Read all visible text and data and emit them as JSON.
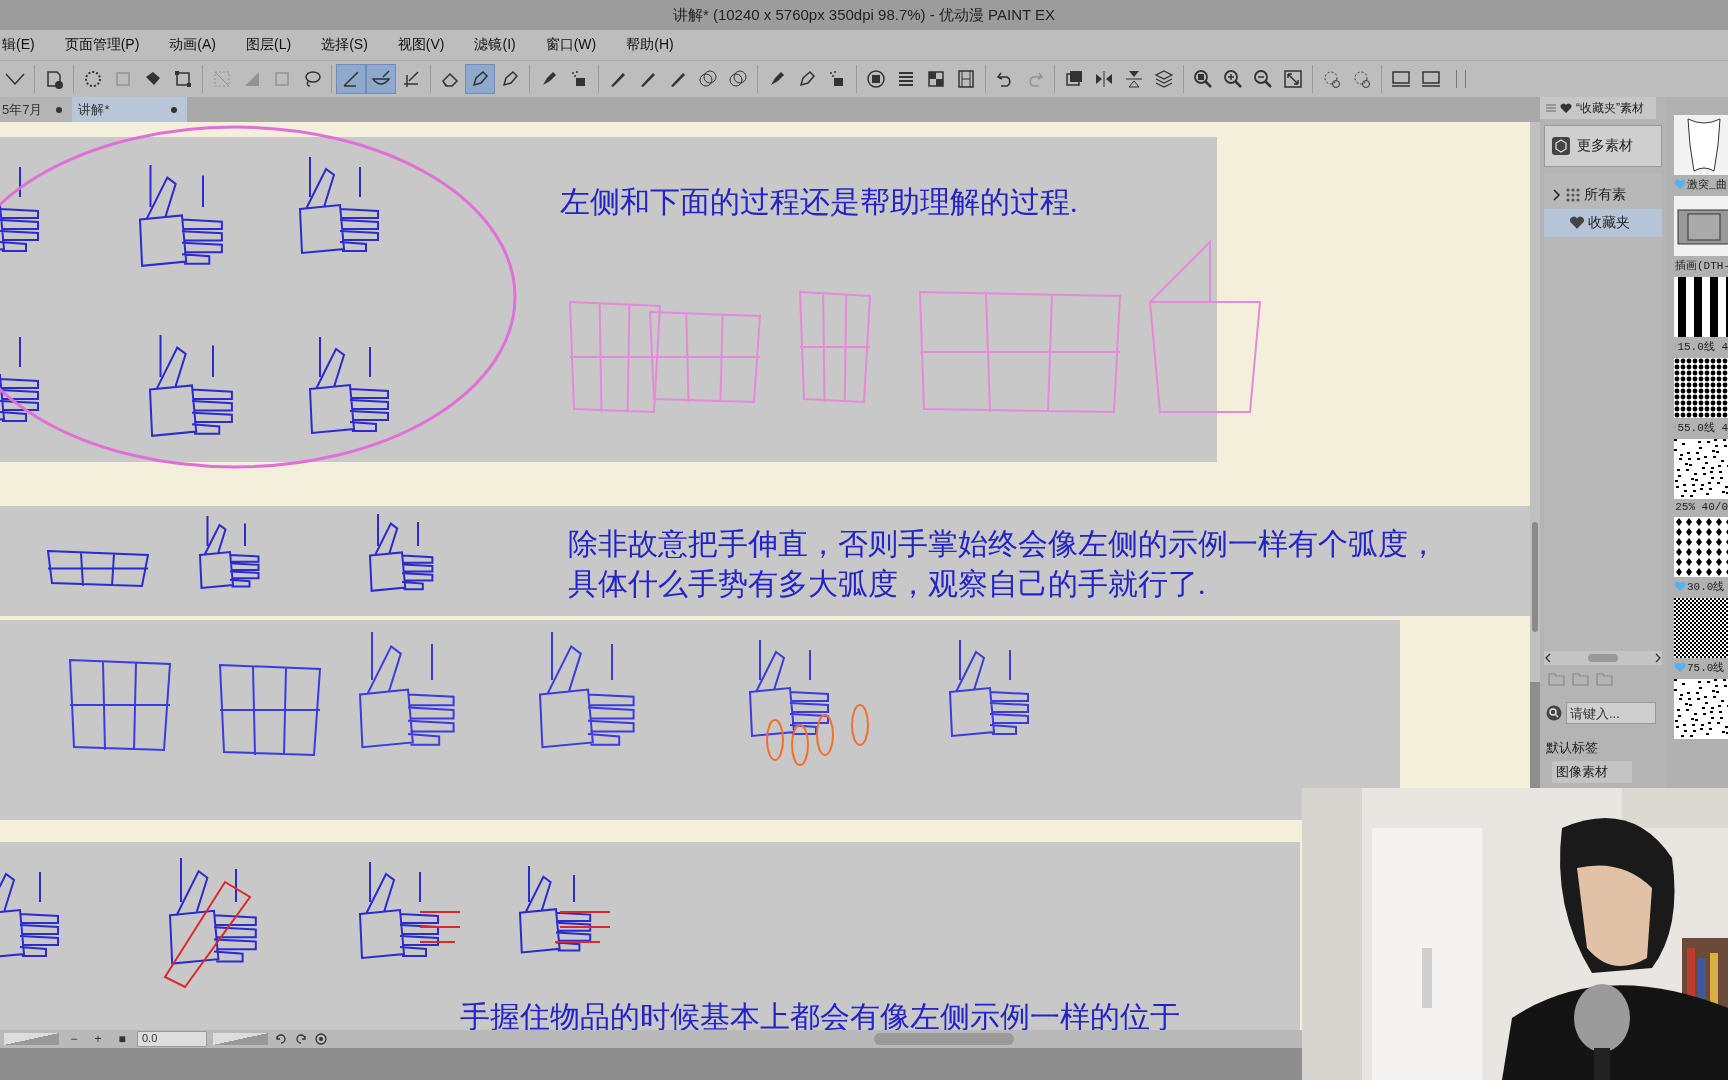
{
  "window": {
    "title": "讲解* (10240 x 5760px 350dpi 98.7%)  - 优动漫 PAINT EX"
  },
  "menu": [
    "辑(E)",
    "页面管理(P)",
    "动画(A)",
    "图层(L)",
    "选择(S)",
    "视图(V)",
    "滤镜(I)",
    "窗口(W)",
    "帮助(H)"
  ],
  "toolbar": [
    {
      "kind": "caret",
      "selected": false,
      "disabled": false
    },
    {
      "kind": "newpage",
      "selected": false,
      "disabled": false
    },
    {
      "kind": "dotcircle",
      "selected": false,
      "disabled": false
    },
    {
      "kind": "square",
      "selected": false,
      "disabled": true
    },
    {
      "kind": "bucket",
      "selected": false,
      "disabled": false
    },
    {
      "kind": "transform",
      "selected": false,
      "disabled": false
    },
    {
      "kind": "diagonal",
      "selected": false,
      "disabled": true
    },
    {
      "kind": "triangle",
      "selected": false,
      "disabled": true
    },
    {
      "kind": "square",
      "selected": false,
      "disabled": true
    },
    {
      "kind": "lasso",
      "selected": false,
      "disabled": false
    },
    {
      "kind": "ruler",
      "selected": true,
      "disabled": false
    },
    {
      "kind": "curve",
      "selected": true,
      "disabled": false
    },
    {
      "kind": "angle",
      "selected": false,
      "disabled": false
    },
    {
      "kind": "eraser",
      "selected": false,
      "disabled": false
    },
    {
      "kind": "pen",
      "selected": true,
      "disabled": false
    },
    {
      "kind": "pen",
      "selected": false,
      "disabled": false
    },
    {
      "kind": "marker",
      "selected": false,
      "disabled": false
    },
    {
      "kind": "spray",
      "selected": false,
      "disabled": false
    },
    {
      "kind": "pencil",
      "selected": false,
      "disabled": false
    },
    {
      "kind": "pencil",
      "selected": false,
      "disabled": false
    },
    {
      "kind": "pencil",
      "selected": false,
      "disabled": false
    },
    {
      "kind": "circles",
      "selected": false,
      "disabled": false
    },
    {
      "kind": "circles",
      "selected": false,
      "disabled": false
    },
    {
      "kind": "marker",
      "selected": false,
      "disabled": false
    },
    {
      "kind": "pen",
      "selected": false,
      "disabled": false
    },
    {
      "kind": "spray",
      "selected": false,
      "disabled": false
    },
    {
      "kind": "ring",
      "selected": false,
      "disabled": false
    },
    {
      "kind": "list",
      "selected": false,
      "disabled": false
    },
    {
      "kind": "grid",
      "selected": false,
      "disabled": false
    },
    {
      "kind": "film",
      "selected": false,
      "disabled": false
    },
    {
      "kind": "undo",
      "selected": false,
      "disabled": false
    },
    {
      "kind": "redo",
      "selected": false,
      "disabled": true
    },
    {
      "kind": "layers",
      "selected": false,
      "disabled": false
    },
    {
      "kind": "fliph",
      "selected": false,
      "disabled": false
    },
    {
      "kind": "flipv",
      "selected": false,
      "disabled": false
    },
    {
      "kind": "stack",
      "selected": false,
      "disabled": false
    },
    {
      "kind": "zoom",
      "selected": false,
      "disabled": false
    },
    {
      "kind": "zoomin",
      "selected": false,
      "disabled": false
    },
    {
      "kind": "zoomout",
      "selected": false,
      "disabled": false
    },
    {
      "kind": "fit",
      "selected": false,
      "disabled": false
    },
    {
      "kind": "rotate",
      "selected": false,
      "disabled": false
    },
    {
      "kind": "rotate",
      "selected": false,
      "disabled": false
    },
    {
      "kind": "monitor",
      "selected": false,
      "disabled": false
    },
    {
      "kind": "monitor",
      "selected": false,
      "disabled": false
    }
  ],
  "document_tabs": [
    {
      "label": "5年7月",
      "selected": false
    },
    {
      "label": "讲解*",
      "selected": true
    }
  ],
  "canvas": {
    "notes": [
      "左侧和下面的过程还是帮助理解的过程.",
      "除非故意把手伸直，否则手掌始终会像左侧的示例一样有个弧度，具体什么手势有多大弧度，观察自己的手就行了.",
      "手握住物品的时候基本上都会有像左侧示例一样的位于"
    ]
  },
  "material_panel": {
    "tab": "“收藏夹”素材",
    "more_button": "更多素材",
    "tree": [
      {
        "label": "所有素",
        "expanded": false,
        "selected": false
      },
      {
        "label": "收藏夹",
        "selected": true
      }
    ],
    "search": {
      "placeholder": "请键入..."
    },
    "tag_header": "默认标签",
    "tags": [
      "图像素材"
    ],
    "materials": [
      {
        "kind": "shape",
        "label": "激突_曲"
      },
      {
        "kind": "frame",
        "label": "插画(DTH-"
      },
      {
        "kind": "stripes",
        "label": "15.0线 4"
      },
      {
        "kind": "dots",
        "label": "55.0线 4"
      },
      {
        "kind": "noise",
        "label": "25% 40/0"
      },
      {
        "kind": "diamonds",
        "label": "30.0线"
      },
      {
        "kind": "checker",
        "label": "75.0线"
      },
      {
        "kind": "noise"
      }
    ]
  },
  "status_bar": {
    "buttons": [
      "−",
      "+",
      "■"
    ],
    "angle": "0.0"
  }
}
